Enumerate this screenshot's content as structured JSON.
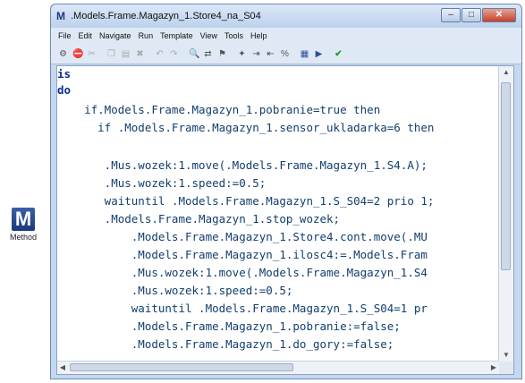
{
  "method_icon": {
    "glyph": "M",
    "label": "Method"
  },
  "window": {
    "app_glyph": "M",
    "title": ".Models.Frame.Magazyn_1.Store4_na_S04",
    "controls": {
      "minimize": "‒",
      "maximize": "□",
      "close": "✕"
    }
  },
  "menu": [
    "File",
    "Edit",
    "Navigate",
    "Run",
    "Template",
    "View",
    "Tools",
    "Help"
  ],
  "toolbar_icons": [
    "build-icon",
    "stop-icon",
    "cut-icon",
    "copy-icon",
    "paste-icon",
    "delete-icon",
    "undo-icon",
    "redo-icon",
    "find-icon",
    "replace-icon",
    "debug-icon",
    "breakpoint-icon",
    "indent-icon",
    "outdent-icon",
    "comment-icon",
    "template-icon",
    "run-icon",
    "apply-icon"
  ],
  "code_lines": [
    "is",
    "do",
    "    if.Models.Frame.Magazyn_1.pobranie=true then",
    "      if .Models.Frame.Magazyn_1.sensor_ukladarka=6 then",
    "",
    "       .Mus.wozek:1.move(.Models.Frame.Magazyn_1.S4.A);",
    "       .Mus.wozek:1.speed:=0.5;",
    "       waituntil .Models.Frame.Magazyn_1.S_S04=2 prio 1;",
    "       .Models.Frame.Magazyn_1.stop_wozek;",
    "           .Models.Frame.Magazyn_1.Store4.cont.move(.MU",
    "           .Models.Frame.Magazyn_1.ilosc4:=.Models.Fram",
    "           .Mus.wozek:1.move(.Models.Frame.Magazyn_1.S4",
    "           .Mus.wozek:1.speed:=0.5;",
    "           waituntil .Models.Frame.Magazyn_1.S_S04=1 pr",
    "           .Models.Frame.Magazyn_1.pobranie:=false;",
    "           .Models.Frame.Magazyn_1.do_gory:=false;"
  ]
}
